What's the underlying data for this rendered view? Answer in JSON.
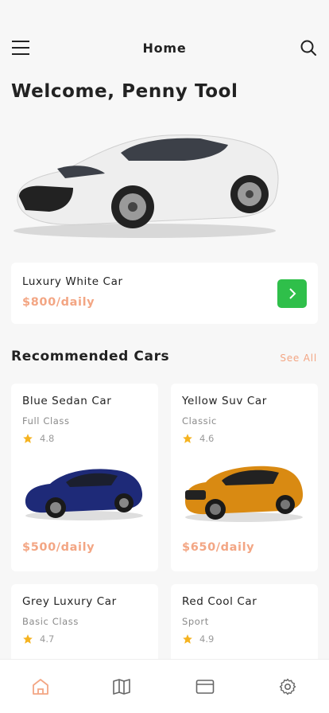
{
  "header": {
    "title": "Home",
    "menu_icon": "hamburger-menu-icon",
    "search_icon": "search-icon"
  },
  "welcome": "Welcome, Penny Tool",
  "featured": {
    "name": "Luxury White Car",
    "price": "$800/daily",
    "button_icon": "chevron-right-icon"
  },
  "recommended": {
    "title": "Recommended Cars",
    "see_all": "See All",
    "cars": [
      {
        "name": "Blue Sedan Car",
        "class": "Full Class",
        "rating": "4.8",
        "price": "$500/daily",
        "color": "#1e2a78"
      },
      {
        "name": "Yellow Suv Car",
        "class": "Classic",
        "rating": "4.6",
        "price": "$650/daily",
        "color": "#d98a12"
      },
      {
        "name": "Grey Luxury Car",
        "class": "Basic Class",
        "rating": "4.7",
        "price": ""
      },
      {
        "name": "Red Cool Car",
        "class": "Sport",
        "rating": "4.9",
        "price": ""
      }
    ]
  },
  "bottom_nav": {
    "items": [
      "home-icon",
      "map-icon",
      "card-icon",
      "settings-icon"
    ],
    "active_color": "#f3a684"
  },
  "colors": {
    "accent": "#f3a684",
    "green": "#2fbf4a"
  }
}
